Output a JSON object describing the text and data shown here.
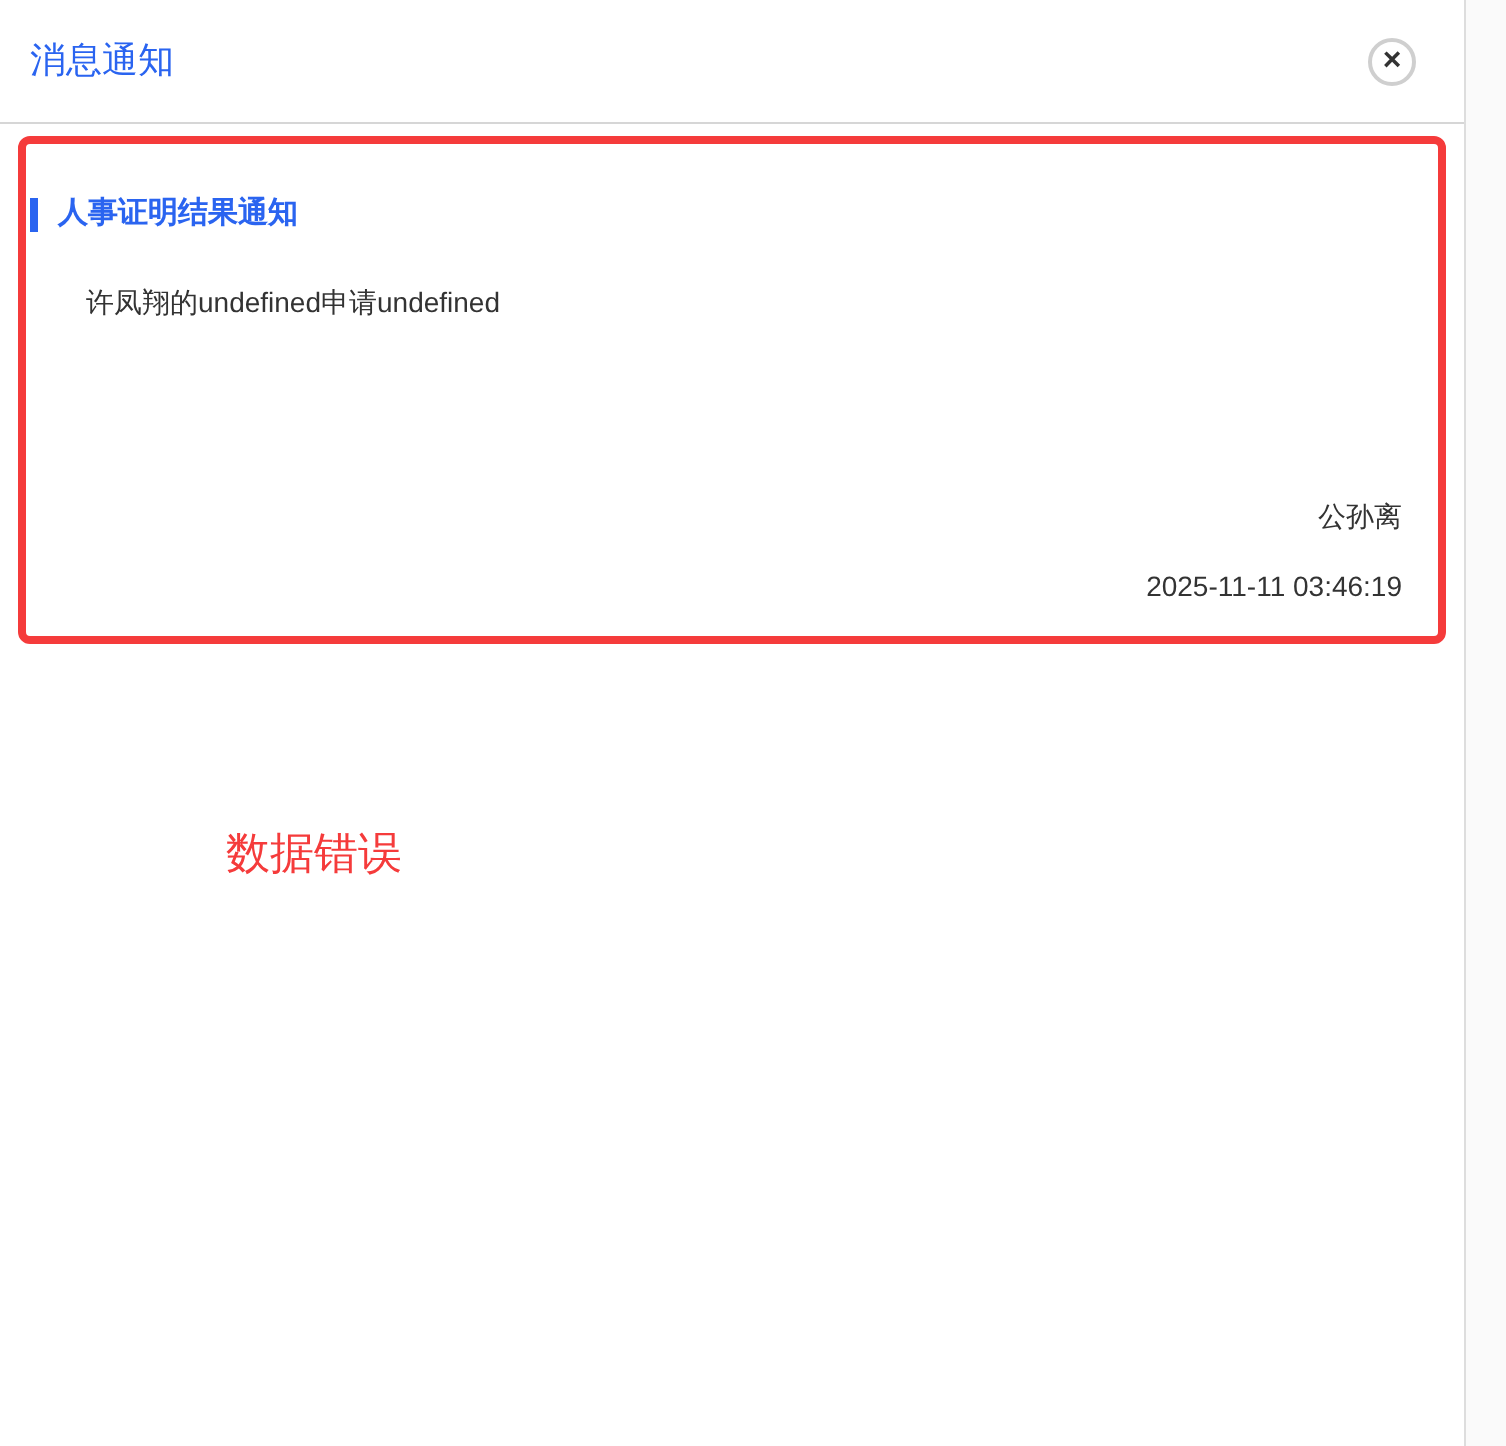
{
  "dialog": {
    "title": "消息通知",
    "close_label": "×"
  },
  "notifications": [
    {
      "title": "人事证明结果通知",
      "body": "许凤翔的undefined申请undefined",
      "sender": "公孙离",
      "time": "2025-11-11 03:46:19"
    }
  ],
  "annotation": {
    "text": "数据错误"
  }
}
